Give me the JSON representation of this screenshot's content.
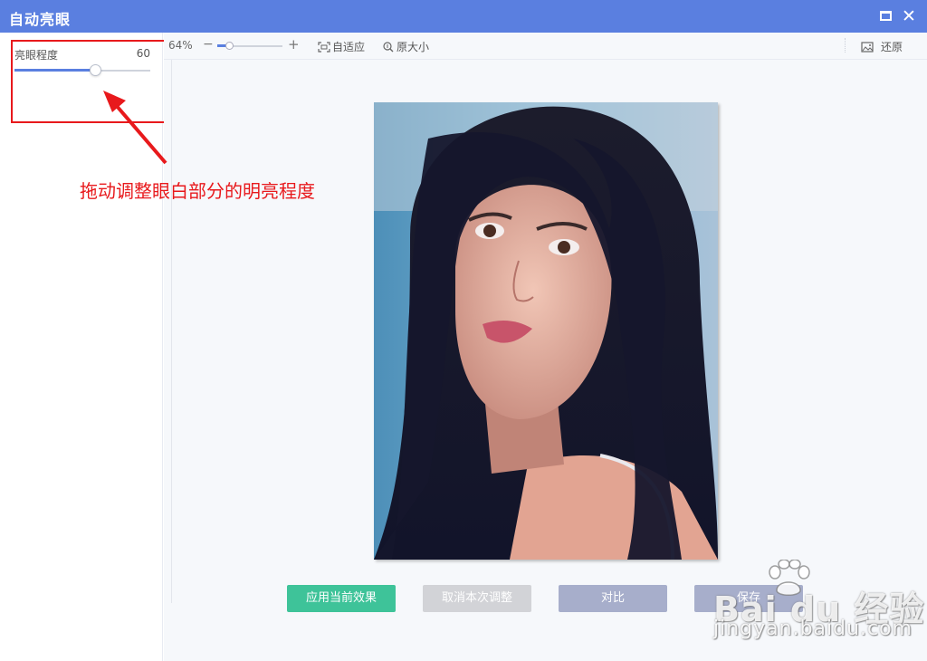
{
  "window": {
    "title": "自动亮眼",
    "maximize_icon": "maximize-icon",
    "close_icon": "close-icon"
  },
  "sidebar": {
    "setting_label": "亮眼程度",
    "setting_value": "60",
    "slider_fraction": 0.6
  },
  "toolbar": {
    "zoom_percent": "64%",
    "zoom_fraction": 0.18,
    "fit_label": "自适应",
    "original_size_label": "原大小",
    "restore_label": "还原"
  },
  "annotation": {
    "text": "拖动调整眼白部分的明亮程度"
  },
  "buttons": {
    "apply": "应用当前效果",
    "cancel": "取消本次调整",
    "compare": "对比",
    "save": "保存"
  },
  "watermark": {
    "brand": "Bai du 经验",
    "url": "jingyan.baidu.com"
  },
  "colors": {
    "titlebar": "#5a7fe0",
    "accent": "#5a7fe0",
    "apply": "#3ec399",
    "annotation": "#e8191c"
  }
}
